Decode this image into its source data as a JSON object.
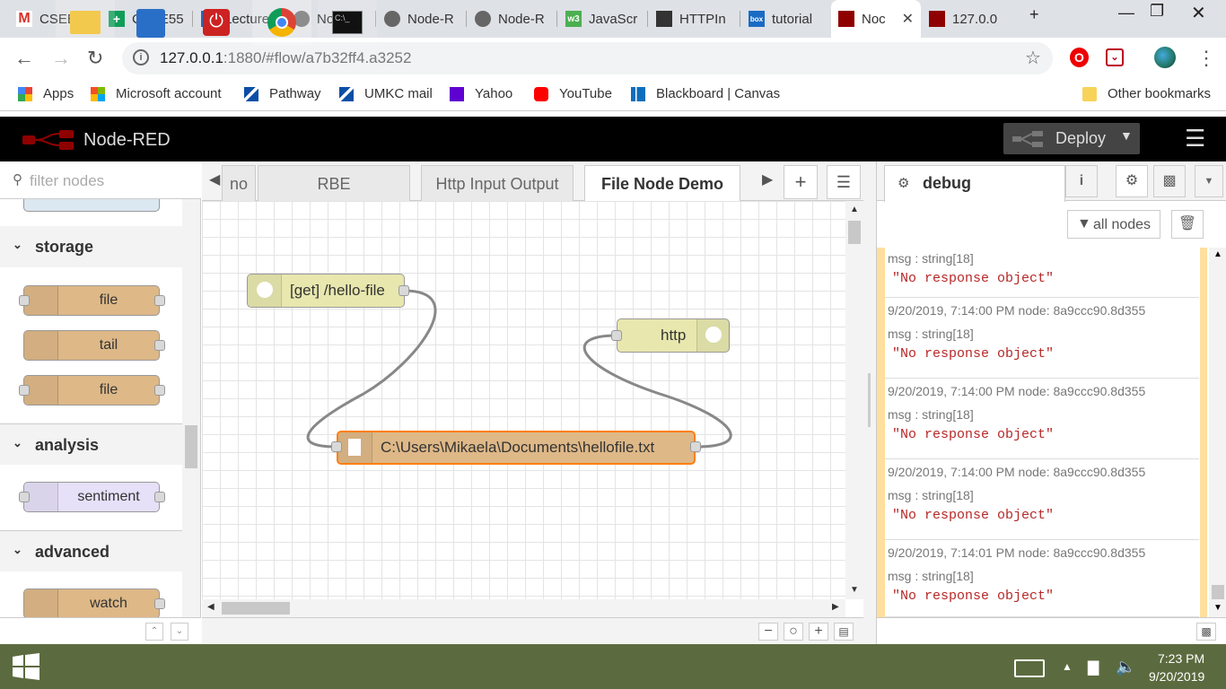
{
  "browser": {
    "tabs": [
      {
        "title": "CSEE55",
        "icon": "gmail-icon",
        "active": false
      },
      {
        "title": "CSEE55",
        "icon": "sheets-icon",
        "active": false
      },
      {
        "title": "Lecture",
        "icon": "box-icon",
        "active": false
      },
      {
        "title": "Node-R",
        "icon": "globe-icon",
        "active": false
      },
      {
        "title": "Node-R",
        "icon": "globe-icon",
        "active": false
      },
      {
        "title": "Node-R",
        "icon": "globe-icon",
        "active": false
      },
      {
        "title": "JavaScr",
        "icon": "w3schools-icon",
        "active": false
      },
      {
        "title": "HTTPIn",
        "icon": "node-icon",
        "active": false
      },
      {
        "title": "tutorial",
        "icon": "box-icon",
        "active": false
      },
      {
        "title": "Noc",
        "icon": "nodered-icon",
        "active": true
      },
      {
        "title": "127.0.0",
        "icon": "nodered-icon",
        "active": false
      }
    ],
    "url_host": "127.0.0.1",
    "url_rest": ":1880/#flow/a7b32ff4.a3252",
    "bookmarks": [
      {
        "label": "Apps",
        "icon": "apps-grid-icon"
      },
      {
        "label": "Microsoft account",
        "icon": "microsoft-icon"
      },
      {
        "label": "Pathway",
        "icon": "umkc-icon"
      },
      {
        "label": "UMKC mail",
        "icon": "umkc-icon"
      },
      {
        "label": "Yahoo",
        "icon": "yahoo-icon"
      },
      {
        "label": "YouTube",
        "icon": "youtube-icon"
      },
      {
        "label": "Blackboard | Canvas",
        "icon": "blackboard-icon"
      }
    ],
    "other_bookmarks": "Other bookmarks"
  },
  "nodered": {
    "title": "Node-RED",
    "deploy_label": "Deploy",
    "palette": {
      "filter_placeholder": "filter nodes",
      "categories": {
        "storage": "storage",
        "analysis": "analysis",
        "advanced": "advanced"
      },
      "nodes": {
        "file1": "file",
        "tail": "tail",
        "file2": "file",
        "sentiment": "sentiment",
        "watch": "watch"
      }
    },
    "workspace_tabs": [
      "no",
      "RBE",
      "Http Input Output",
      "File Node Demo"
    ],
    "flow_nodes": {
      "http_in": "[get] /hello-file",
      "http_response": "http",
      "file_in": "C:\\Users\\Mikaela\\Documents\\hellofile.txt"
    },
    "sidebar": {
      "tab": "debug",
      "filter": "all nodes",
      "messages": [
        {
          "meta": "",
          "topic": "msg : string[18]",
          "value": "\"No response object\""
        },
        {
          "meta": "9/20/2019, 7:14:00 PM   node: 8a9ccc90.8d355",
          "topic": "msg : string[18]",
          "value": "\"No response object\""
        },
        {
          "meta": "9/20/2019, 7:14:00 PM   node: 8a9ccc90.8d355",
          "topic": "msg : string[18]",
          "value": "\"No response object\""
        },
        {
          "meta": "9/20/2019, 7:14:00 PM   node: 8a9ccc90.8d355",
          "topic": "msg : string[18]",
          "value": "\"No response object\""
        },
        {
          "meta": "9/20/2019, 7:14:01 PM   node: 8a9ccc90.8d355",
          "topic": "msg : string[18]",
          "value": "\"No response object\""
        }
      ]
    }
  },
  "taskbar": {
    "time": "7:23 PM",
    "date": "9/20/2019"
  }
}
